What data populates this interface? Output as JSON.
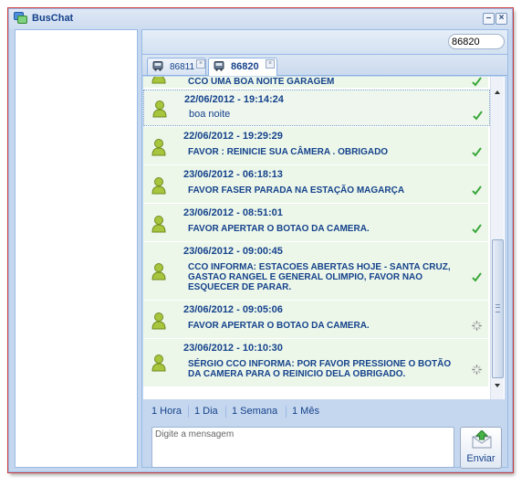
{
  "window": {
    "title": "BusChat"
  },
  "toolbar": {
    "search_value": "86820"
  },
  "tabs": [
    {
      "label": "86811",
      "active": false
    },
    {
      "label": "86820",
      "active": true
    }
  ],
  "messages": [
    {
      "time": "",
      "text": "CCO UMA BOA NOITE GARAGEM",
      "status": "sent"
    },
    {
      "time": "22/06/2012 - 19:14:24",
      "text": "boa noite",
      "status": "sent"
    },
    {
      "time": "22/06/2012 - 19:29:29",
      "text": "FAVOR : REINICIE SUA CÂMERA . OBRIGADO",
      "status": "sent"
    },
    {
      "time": "23/06/2012 - 06:18:13",
      "text": "FAVOR FASER PARADA NA ESTAÇÃO MAGARÇA",
      "status": "sent"
    },
    {
      "time": "23/06/2012 - 08:51:01",
      "text": "FAVOR APERTAR O BOTAO DA CAMERA.",
      "status": "sent"
    },
    {
      "time": "23/06/2012 - 09:00:45",
      "text": "CCO INFORMA: ESTACOES ABERTAS HOJE - SANTA CRUZ, GASTAO RANGEL E GENERAL OLIMPIO, FAVOR NAO ESQUECER DE PARAR.",
      "status": "sent"
    },
    {
      "time": "23/06/2012 - 09:05:06",
      "text": "FAVOR APERTAR O BOTAO DA CAMERA.",
      "status": "pending"
    },
    {
      "time": "23/06/2012 - 10:10:30",
      "text": "SÉRGIO CCO INFORMA: POR FAVOR PRESSIONE O BOTÃO DA CAMERA PARA O REINICIO DELA OBRIGADO.",
      "status": "pending"
    }
  ],
  "time_filters": [
    "1 Hora",
    "1 Dia",
    "1 Semana",
    "1 Mês"
  ],
  "composer": {
    "placeholder": "Digite a mensagem"
  },
  "send_button": {
    "label": "Enviar"
  },
  "colors": {
    "accent": "#15428b",
    "message_bg": "#ecf7ea",
    "check": "#3aa83a"
  },
  "icons": [
    "buschat-app-icon",
    "minimize-icon",
    "close-icon",
    "bus-icon",
    "tab-close-icon",
    "user-icon",
    "check-icon",
    "pending-spinner-icon",
    "send-icon"
  ]
}
